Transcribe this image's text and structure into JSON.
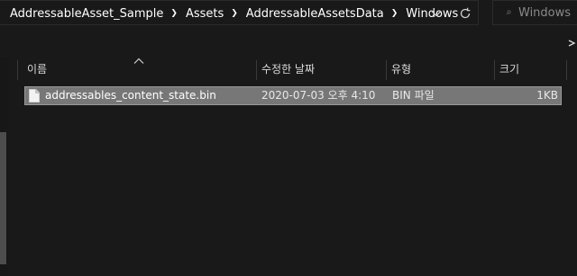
{
  "breadcrumb": [
    {
      "label": "AddressableAsset_Sample"
    },
    {
      "label": "Assets"
    },
    {
      "label": "AddressableAssetsData"
    },
    {
      "label": "Windows"
    }
  ],
  "search": {
    "placeholder": "Windows"
  },
  "columns": {
    "name": "이름",
    "modified": "수정한 날짜",
    "type": "유형",
    "size": "크기"
  },
  "files": [
    {
      "name": "addressables_content_state.bin",
      "modified": "2020-07-03 오후 4:10",
      "type": "BIN 파일",
      "size": "1KB"
    }
  ],
  "icons": {
    "history": "chevron-down-icon",
    "refresh": "refresh-icon",
    "search": "search-icon",
    "separator": "chevron-right-icon",
    "file": "file-icon",
    "sort": "sort-up-icon"
  },
  "colors": {
    "background": "#191919",
    "selected_row": "#777777",
    "selected_border": "#999999"
  }
}
